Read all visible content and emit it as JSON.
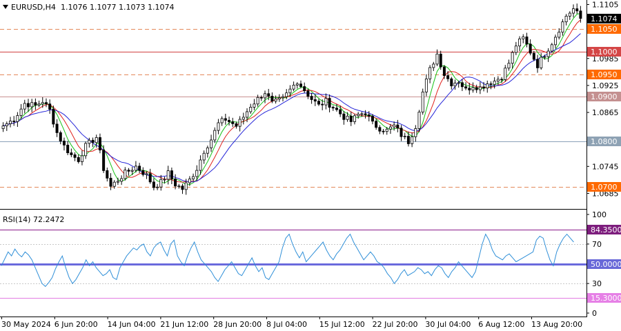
{
  "window": {
    "symbol_label": "EURUSD,H4",
    "ohlc_label": "1.1076 1.1077 1.1073 1.1074",
    "symbol_toggle_icon": "triangle-down-icon"
  },
  "chart_data": [
    {
      "type": "candlestick",
      "symbol": "EURUSD",
      "timeframe": "H4",
      "last_ohlc": {
        "open": 1.1076,
        "high": 1.1077,
        "low": 1.1073,
        "close": 1.1074
      },
      "ylim": [
        1.0655,
        1.1115
      ],
      "y_ticks": [
        "1.1105",
        "1.0985",
        "1.0925",
        "1.0865",
        "1.0745",
        "1.0685"
      ],
      "x_tick_labels": [
        "30 May 2024",
        "6 Jun 20:00",
        "14 Jun 04:00",
        "21 Jun 12:00",
        "28 Jun 20:00",
        "8 Jul 04:00",
        "15 Jul 12:00",
        "22 Jul 20:00",
        "30 Jul 04:00",
        "6 Aug 12:00",
        "13 Aug 20:00"
      ],
      "close_path": [
        [
          0,
          1.0835
        ],
        [
          3,
          1.085
        ],
        [
          6,
          1.0885
        ],
        [
          9,
          1.088
        ],
        [
          11,
          1.089
        ],
        [
          13,
          1.087
        ],
        [
          15,
          1.082
        ],
        [
          17,
          1.079
        ],
        [
          19,
          1.077
        ],
        [
          21,
          1.076
        ],
        [
          23,
          1.079
        ],
        [
          26,
          1.081
        ],
        [
          28,
          1.074
        ],
        [
          30,
          1.07
        ],
        [
          32,
          1.0715
        ],
        [
          34,
          1.073
        ],
        [
          37,
          1.0745
        ],
        [
          40,
          1.0725
        ],
        [
          42,
          1.07
        ],
        [
          44,
          1.071
        ],
        [
          46,
          1.073
        ],
        [
          48,
          1.0705
        ],
        [
          50,
          1.0695
        ],
        [
          52,
          1.0715
        ],
        [
          54,
          1.074
        ],
        [
          56,
          1.078
        ],
        [
          58,
          1.0805
        ],
        [
          60,
          1.084
        ],
        [
          62,
          1.085
        ],
        [
          65,
          1.0835
        ],
        [
          67,
          1.0855
        ],
        [
          69,
          1.088
        ],
        [
          71,
          1.0895
        ],
        [
          73,
          1.091
        ],
        [
          75,
          1.0885
        ],
        [
          78,
          1.0895
        ],
        [
          80,
          1.0915
        ],
        [
          82,
          1.0935
        ],
        [
          84,
          1.0915
        ],
        [
          86,
          1.0895
        ],
        [
          88,
          1.088
        ],
        [
          90,
          1.089
        ],
        [
          93,
          1.087
        ],
        [
          95,
          1.0855
        ],
        [
          97,
          1.0845
        ],
        [
          99,
          1.086
        ],
        [
          101,
          1.0865
        ],
        [
          103,
          1.084
        ],
        [
          105,
          1.083
        ],
        [
          107,
          1.0825
        ],
        [
          109,
          1.0835
        ],
        [
          111,
          1.0815
        ],
        [
          113,
          1.08
        ],
        [
          115,
          1.0835
        ],
        [
          117,
          1.091
        ],
        [
          119,
          1.096
        ],
        [
          121,
          1.0995
        ],
        [
          123,
          1.095
        ],
        [
          125,
          1.093
        ],
        [
          127,
          1.0935
        ],
        [
          129,
          1.0915
        ],
        [
          131,
          1.0925
        ],
        [
          133,
          1.092
        ],
        [
          135,
          1.093
        ],
        [
          137,
          1.0935
        ],
        [
          139,
          1.0945
        ],
        [
          141,
          1.0975
        ],
        [
          143,
          1.1015
        ],
        [
          145,
          1.103
        ],
        [
          147,
          1.1
        ],
        [
          149,
          1.097
        ],
        [
          151,
          1.0995
        ],
        [
          153,
          1.102
        ],
        [
          155,
          1.105
        ],
        [
          157,
          1.108
        ],
        [
          159,
          1.1095
        ],
        [
          160,
          1.1085
        ],
        [
          161,
          1.1074
        ]
      ],
      "moving_averages": [
        {
          "name": "fast",
          "color": "#16c216",
          "period_bars": 5
        },
        {
          "name": "medium",
          "color": "#e0201c",
          "period_bars": 8
        },
        {
          "name": "slow",
          "color": "#2424d8",
          "period_bars": 13
        }
      ],
      "levels": [
        {
          "label": "1.1050",
          "value": 1.105,
          "style": "dashed",
          "line_color": "#e4885a",
          "tag_color": "#ff6a00"
        },
        {
          "label": "1.1000",
          "value": 1.1,
          "style": "solid",
          "line_color": "#d04040",
          "tag_color": "#d44646"
        },
        {
          "label": "1.0950",
          "value": 1.095,
          "style": "dashed",
          "line_color": "#e4885a",
          "tag_color": "#ff6a00"
        },
        {
          "label": "1.0900",
          "value": 1.09,
          "style": "solid",
          "line_color": "#c89090",
          "tag_color": "#c49090"
        },
        {
          "label": "1.0800",
          "value": 1.08,
          "style": "solid",
          "line_color": "#8aa0b8",
          "tag_color": "#8ea2b4"
        },
        {
          "label": "1.0700",
          "value": 1.07,
          "style": "dashed",
          "line_color": "#e4885a",
          "tag_color": "#ff6a00"
        }
      ],
      "current_price_label": "1.1074",
      "current_price": 1.1074
    },
    {
      "type": "line",
      "title": "RSI(14) 72.2472",
      "indicator": "RSI",
      "period": 14,
      "last_value": 72.2472,
      "color": "#2f8fd8",
      "ylim": [
        0,
        100
      ],
      "y_ticks": [
        "100",
        "70",
        "30",
        "0"
      ],
      "guide_levels": [
        70,
        30
      ],
      "values": [
        48,
        55,
        62,
        58,
        65,
        60,
        57,
        62,
        59,
        54,
        46,
        38,
        30,
        27,
        31,
        36,
        45,
        52,
        58,
        46,
        36,
        30,
        34,
        40,
        46,
        54,
        48,
        52,
        46,
        42,
        38,
        40,
        44,
        36,
        34,
        46,
        52,
        58,
        62,
        66,
        64,
        68,
        70,
        62,
        58,
        66,
        70,
        72,
        64,
        58,
        70,
        74,
        58,
        52,
        48,
        58,
        66,
        72,
        62,
        54,
        50,
        46,
        42,
        36,
        32,
        38,
        44,
        48,
        52,
        46,
        40,
        38,
        44,
        50,
        56,
        48,
        42,
        46,
        36,
        34,
        40,
        46,
        52,
        66,
        76,
        80,
        70,
        62,
        56,
        62,
        52,
        56,
        60,
        64,
        68,
        72,
        64,
        58,
        54,
        60,
        64,
        70,
        76,
        80,
        72,
        66,
        60,
        54,
        58,
        62,
        58,
        52,
        50,
        46,
        40,
        36,
        30,
        34,
        40,
        44,
        38,
        40,
        42,
        46,
        44,
        40,
        42,
        38,
        44,
        48,
        46,
        40,
        36,
        42,
        46,
        52,
        48,
        44,
        40,
        36,
        42,
        56,
        70,
        80,
        74,
        64,
        58,
        56,
        54,
        58,
        60,
        56,
        52,
        54,
        56,
        58,
        60,
        62,
        74,
        78,
        76,
        64,
        54,
        48,
        62,
        70,
        76,
        80,
        76,
        72
      ],
      "levels": [
        {
          "label": "84.3500",
          "value": 84.35,
          "line_color": "#8a1a8a",
          "tag_color": "#7d1d7d"
        },
        {
          "label": "50.0000",
          "value": 50.0,
          "line_color": "#6a6adc",
          "tag_color": "#6868d8"
        },
        {
          "label": "15.3000",
          "value": 15.3,
          "line_color": "#e27de2",
          "tag_color": "#e680e6"
        }
      ]
    }
  ]
}
